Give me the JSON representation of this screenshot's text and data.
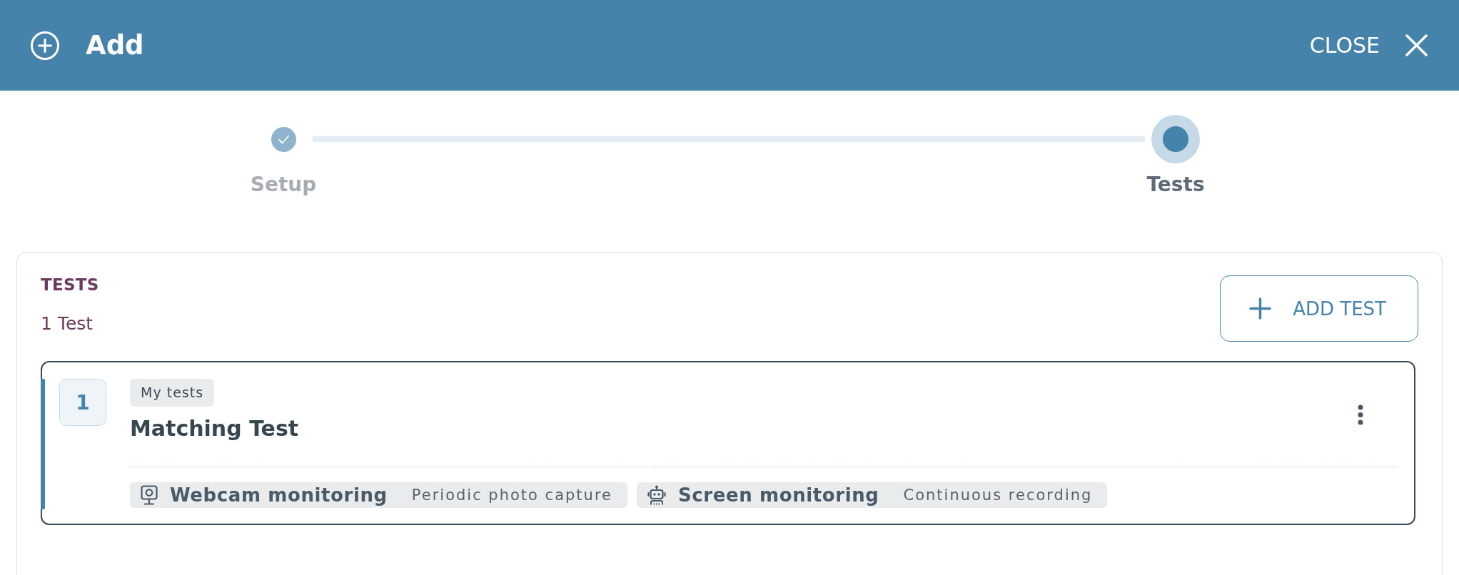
{
  "header": {
    "title": "Add",
    "close_label": "CLOSE"
  },
  "stepper": {
    "steps": [
      {
        "label": "Setup",
        "completed": true,
        "selected": false
      },
      {
        "label": "Tests",
        "completed": false,
        "selected": true
      }
    ]
  },
  "tests_panel": {
    "heading": "TESTS",
    "count": "1 Test",
    "add_button": "ADD TEST",
    "tests": [
      {
        "number": "1",
        "tag": "My tests",
        "title": "Matching Test",
        "features": [
          {
            "kind": "webcam",
            "name": "Webcam monitoring",
            "detail": "Periodic photo capture"
          },
          {
            "kind": "screen",
            "name": "Screen monitoring",
            "detail": "Continuous recording"
          }
        ]
      }
    ]
  }
}
